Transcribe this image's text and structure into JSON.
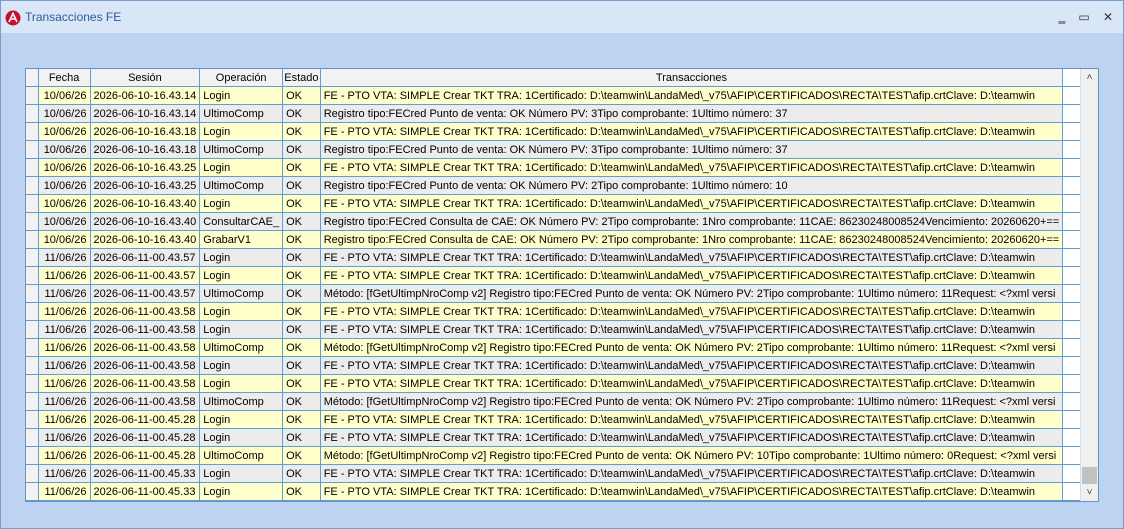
{
  "window": {
    "title": "Transacciones FE",
    "minimize_glyph": "‗",
    "maximize_glyph": "▭",
    "close_glyph": "✕"
  },
  "scroll": {
    "up_glyph": "˄",
    "down_glyph": "˅",
    "position_fraction": 1.0
  },
  "table": {
    "headers": {
      "fecha": "Fecha",
      "sesion": "Sesión",
      "operacion": "Operación",
      "estado": "Estado",
      "transacciones": "Transacciones"
    },
    "rows": [
      {
        "fecha": "10/06/26",
        "sesion": "2026-06-10-16.43.14",
        "operacion": "Login",
        "estado": "OK",
        "transaccion": "FE - PTO VTA: SIMPLE Crear TKT TRA: 1Certificado: D:\\teamwin\\LandaMed\\_v75\\AFIP\\CERTIFICADOS\\RECTA\\TEST\\afip.crtClave: D:\\teamwin",
        "tone": "yellow"
      },
      {
        "fecha": "10/06/26",
        "sesion": "2026-06-10-16.43.14",
        "operacion": "UltimoComp",
        "estado": "OK",
        "transaccion": "Registro tipo:FECred Punto de venta: OK Número PV: 3Tipo comprobante: 1Ultimo número: 37",
        "tone": "gray"
      },
      {
        "fecha": "10/06/26",
        "sesion": "2026-06-10-16.43.18",
        "operacion": "Login",
        "estado": "OK",
        "transaccion": "FE - PTO VTA: SIMPLE Crear TKT TRA: 1Certificado: D:\\teamwin\\LandaMed\\_v75\\AFIP\\CERTIFICADOS\\RECTA\\TEST\\afip.crtClave: D:\\teamwin",
        "tone": "yellow"
      },
      {
        "fecha": "10/06/26",
        "sesion": "2026-06-10-16.43.18",
        "operacion": "UltimoComp",
        "estado": "OK",
        "transaccion": "Registro tipo:FECred Punto de venta: OK Número PV: 3Tipo comprobante: 1Ultimo número: 37",
        "tone": "gray"
      },
      {
        "fecha": "10/06/26",
        "sesion": "2026-06-10-16.43.25",
        "operacion": "Login",
        "estado": "OK",
        "transaccion": "FE - PTO VTA: SIMPLE Crear TKT TRA: 1Certificado: D:\\teamwin\\LandaMed\\_v75\\AFIP\\CERTIFICADOS\\RECTA\\TEST\\afip.crtClave: D:\\teamwin",
        "tone": "yellow"
      },
      {
        "fecha": "10/06/26",
        "sesion": "2026-06-10-16.43.25",
        "operacion": "UltimoComp",
        "estado": "OK",
        "transaccion": "Registro tipo:FECred Punto de venta: OK Número PV: 2Tipo comprobante: 1Ultimo número: 10",
        "tone": "gray"
      },
      {
        "fecha": "10/06/26",
        "sesion": "2026-06-10-16.43.40",
        "operacion": "Login",
        "estado": "OK",
        "transaccion": "FE - PTO VTA: SIMPLE Crear TKT TRA: 1Certificado: D:\\teamwin\\LandaMed\\_v75\\AFIP\\CERTIFICADOS\\RECTA\\TEST\\afip.crtClave: D:\\teamwin",
        "tone": "yellow"
      },
      {
        "fecha": "10/06/26",
        "sesion": "2026-06-10-16.43.40",
        "operacion": "ConsultarCAE_",
        "estado": "OK",
        "transaccion": "Registro tipo:FECred Consulta de CAE: OK Número PV: 2Tipo comprobante: 1Nro comprobante: 11CAE: 86230248008524Vencimiento: 20260620+==",
        "tone": "gray"
      },
      {
        "fecha": "10/06/26",
        "sesion": "2026-06-10-16.43.40",
        "operacion": "GrabarV1",
        "estado": "OK",
        "transaccion": "Registro tipo:FECred Consulta de CAE: OK Número PV: 2Tipo comprobante: 1Nro comprobante: 11CAE: 86230248008524Vencimiento: 20260620+==",
        "tone": "yellow"
      },
      {
        "fecha": "11/06/26",
        "sesion": "2026-06-11-00.43.57",
        "operacion": "Login",
        "estado": "OK",
        "transaccion": "FE - PTO VTA: SIMPLE Crear TKT TRA: 1Certificado: D:\\teamwin\\LandaMed\\_v75\\AFIP\\CERTIFICADOS\\RECTA\\TEST\\afip.crtClave: D:\\teamwin",
        "tone": "gray"
      },
      {
        "fecha": "11/06/26",
        "sesion": "2026-06-11-00.43.57",
        "operacion": "Login",
        "estado": "OK",
        "transaccion": "FE - PTO VTA: SIMPLE Crear TKT TRA: 1Certificado: D:\\teamwin\\LandaMed\\_v75\\AFIP\\CERTIFICADOS\\RECTA\\TEST\\afip.crtClave: D:\\teamwin",
        "tone": "yellow"
      },
      {
        "fecha": "11/06/26",
        "sesion": "2026-06-11-00.43.57",
        "operacion": "UltimoComp",
        "estado": "OK",
        "transaccion": "Método: [fGetUltimpNroComp v2] Registro tipo:FECred Punto de venta: OK Número PV: 2Tipo comprobante: 1Ultimo número: 11Request: <?xml versi",
        "tone": "gray"
      },
      {
        "fecha": "11/06/26",
        "sesion": "2026-06-11-00.43.58",
        "operacion": "Login",
        "estado": "OK",
        "transaccion": "FE - PTO VTA: SIMPLE Crear TKT TRA: 1Certificado: D:\\teamwin\\LandaMed\\_v75\\AFIP\\CERTIFICADOS\\RECTA\\TEST\\afip.crtClave: D:\\teamwin",
        "tone": "yellow"
      },
      {
        "fecha": "11/06/26",
        "sesion": "2026-06-11-00.43.58",
        "operacion": "Login",
        "estado": "OK",
        "transaccion": "FE - PTO VTA: SIMPLE Crear TKT TRA: 1Certificado: D:\\teamwin\\LandaMed\\_v75\\AFIP\\CERTIFICADOS\\RECTA\\TEST\\afip.crtClave: D:\\teamwin",
        "tone": "gray"
      },
      {
        "fecha": "11/06/26",
        "sesion": "2026-06-11-00.43.58",
        "operacion": "UltimoComp",
        "estado": "OK",
        "transaccion": "Método: [fGetUltimpNroComp v2] Registro tipo:FECred Punto de venta: OK Número PV: 2Tipo comprobante: 1Ultimo número: 11Request: <?xml versi",
        "tone": "yellow"
      },
      {
        "fecha": "11/06/26",
        "sesion": "2026-06-11-00.43.58",
        "operacion": "Login",
        "estado": "OK",
        "transaccion": "FE - PTO VTA: SIMPLE Crear TKT TRA: 1Certificado: D:\\teamwin\\LandaMed\\_v75\\AFIP\\CERTIFICADOS\\RECTA\\TEST\\afip.crtClave: D:\\teamwin",
        "tone": "gray"
      },
      {
        "fecha": "11/06/26",
        "sesion": "2026-06-11-00.43.58",
        "operacion": "Login",
        "estado": "OK",
        "transaccion": "FE - PTO VTA: SIMPLE Crear TKT TRA: 1Certificado: D:\\teamwin\\LandaMed\\_v75\\AFIP\\CERTIFICADOS\\RECTA\\TEST\\afip.crtClave: D:\\teamwin",
        "tone": "yellow"
      },
      {
        "fecha": "11/06/26",
        "sesion": "2026-06-11-00.43.58",
        "operacion": "UltimoComp",
        "estado": "OK",
        "transaccion": "Método: [fGetUltimpNroComp v2] Registro tipo:FECred Punto de venta: OK Número PV: 2Tipo comprobante: 1Ultimo número: 11Request: <?xml versi",
        "tone": "gray"
      },
      {
        "fecha": "11/06/26",
        "sesion": "2026-06-11-00.45.28",
        "operacion": "Login",
        "estado": "OK",
        "transaccion": "FE - PTO VTA: SIMPLE Crear TKT TRA: 1Certificado: D:\\teamwin\\LandaMed\\_v75\\AFIP\\CERTIFICADOS\\RECTA\\TEST\\afip.crtClave: D:\\teamwin",
        "tone": "yellow"
      },
      {
        "fecha": "11/06/26",
        "sesion": "2026-06-11-00.45.28",
        "operacion": "Login",
        "estado": "OK",
        "transaccion": "FE - PTO VTA: SIMPLE Crear TKT TRA: 1Certificado: D:\\teamwin\\LandaMed\\_v75\\AFIP\\CERTIFICADOS\\RECTA\\TEST\\afip.crtClave: D:\\teamwin",
        "tone": "gray"
      },
      {
        "fecha": "11/06/26",
        "sesion": "2026-06-11-00.45.28",
        "operacion": "UltimoComp",
        "estado": "OK",
        "transaccion": "Método: [fGetUltimpNroComp v2] Registro tipo:FECred Punto de venta: OK Número PV: 10Tipo comprobante: 1Ultimo número: 0Request: <?xml versi",
        "tone": "yellow"
      },
      {
        "fecha": "11/06/26",
        "sesion": "2026-06-11-00.45.33",
        "operacion": "Login",
        "estado": "OK",
        "transaccion": "FE - PTO VTA: SIMPLE Crear TKT TRA: 1Certificado: D:\\teamwin\\LandaMed\\_v75\\AFIP\\CERTIFICADOS\\RECTA\\TEST\\afip.crtClave: D:\\teamwin",
        "tone": "gray"
      },
      {
        "fecha": "11/06/26",
        "sesion": "2026-06-11-00.45.33",
        "operacion": "Login",
        "estado": "OK",
        "transaccion": "FE - PTO VTA: SIMPLE Crear TKT TRA: 1Certificado: D:\\teamwin\\LandaMed\\_v75\\AFIP\\CERTIFICADOS\\RECTA\\TEST\\afip.crtClave: D:\\teamwin",
        "tone": "yellow"
      }
    ]
  }
}
